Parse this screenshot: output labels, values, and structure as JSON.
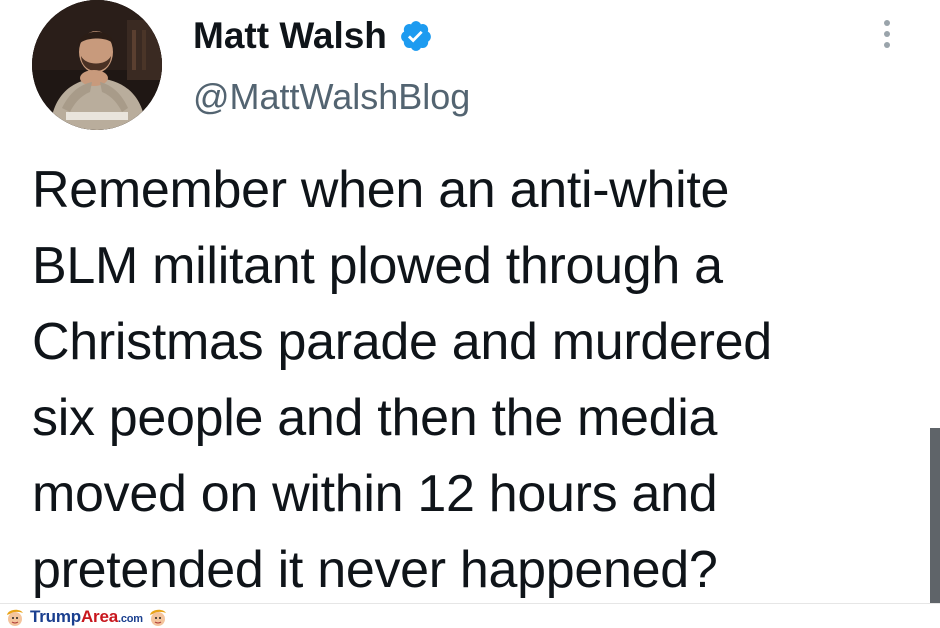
{
  "author": {
    "display_name": "Matt Walsh",
    "handle": "@MattWalshBlog",
    "verified": true
  },
  "tweet": {
    "text_lines": [
      "Remember when an anti-white",
      "BLM militant plowed through a",
      "Christmas parade and murdered",
      "six people and then the media",
      "moved on within 12 hours and",
      "pretended it never happened?"
    ]
  },
  "icons": {
    "verified": "verified-badge-icon",
    "more": "more-options-icon"
  },
  "colors": {
    "verified_blue": "#1d9bf0",
    "handle_gray": "#536471",
    "text": "#0f1419"
  },
  "watermark": {
    "brand_part1": "Trump",
    "brand_part2": "Area",
    "brand_suffix": ".com"
  }
}
